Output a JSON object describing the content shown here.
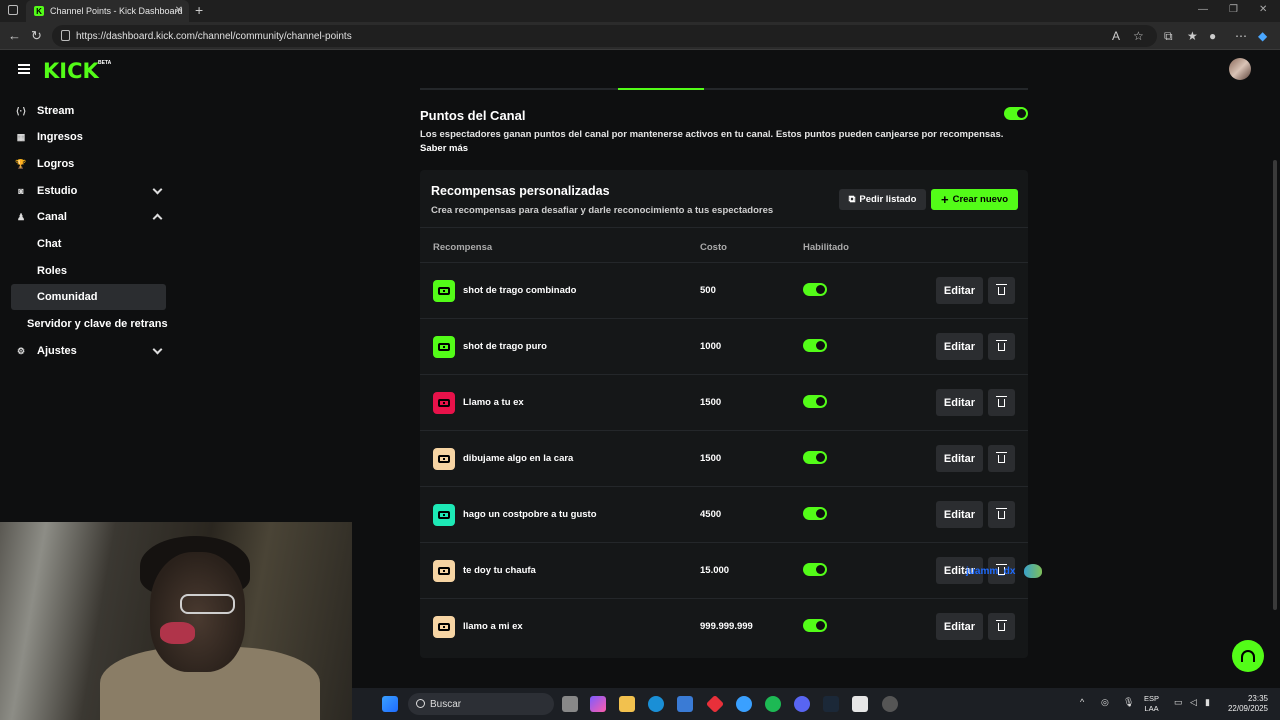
{
  "browser": {
    "tab_title": "Channel Points - Kick Dashboard",
    "url": "https://dashboard.kick.com/channel/community/channel-points"
  },
  "app": {
    "logo": "KICK",
    "logo_badge": "BETA"
  },
  "sidebar": {
    "items": [
      {
        "label": "Stream",
        "icon": "⟨·⟩"
      },
      {
        "label": "Ingresos",
        "icon": "▦"
      },
      {
        "label": "Logros",
        "icon": "🏆"
      },
      {
        "label": "Estudio",
        "icon": "◙"
      },
      {
        "label": "Canal",
        "icon": "♟"
      },
      {
        "label": "Chat"
      },
      {
        "label": "Roles"
      },
      {
        "label": "Comunidad"
      },
      {
        "label": "Servidor y clave de retrans"
      },
      {
        "label": "Ajustes",
        "icon": "⚙"
      }
    ]
  },
  "channel_points": {
    "title": "Puntos del Canal",
    "description": "Los espectadores ganan puntos del canal por mantenerse activos en tu canal. Estos puntos pueden canjearse por recompensas.",
    "learn_more": "Saber más",
    "enabled": true
  },
  "rewards": {
    "title": "Recompensas personalizadas",
    "subtitle": "Crea recompensas para desafiar y darle reconocimiento a tus espectadores",
    "request_list_label": "Pedir listado",
    "create_new_label": "Crear nuevo",
    "columns": {
      "reward": "Recompensa",
      "cost": "Costo",
      "enabled": "Habilitado"
    },
    "edit_label": "Editar",
    "items": [
      {
        "name": "shot de trago combinado",
        "cost": "500",
        "color": "#53fc18",
        "enabled": true
      },
      {
        "name": "shot de trago puro",
        "cost": "1000",
        "color": "#53fc18",
        "enabled": true
      },
      {
        "name": "Llamo a tu ex",
        "cost": "1500",
        "color": "#e8124a",
        "enabled": true
      },
      {
        "name": "dibujame algo en la cara",
        "cost": "1500",
        "color": "#f6d4a3",
        "enabled": true
      },
      {
        "name": "hago un costpobre a tu gusto",
        "cost": "4500",
        "color": "#1de9b6",
        "enabled": true
      },
      {
        "name": "te doy tu chaufa",
        "cost": "15.000",
        "color": "#f6d4a3",
        "enabled": true
      },
      {
        "name": "llamo a mi ex",
        "cost": "999.999.999",
        "color": "#f6d4a3",
        "enabled": true
      }
    ]
  },
  "overlay": {
    "text": "juamm_dx"
  },
  "taskbar": {
    "search_placeholder": "Buscar",
    "lang_top": "ESP",
    "lang_bottom": "LAA",
    "time": "23:35",
    "date": "22/09/2025"
  },
  "colors": {
    "accent": "#53fc18",
    "panel": "#151718",
    "background": "#0e0f10"
  }
}
